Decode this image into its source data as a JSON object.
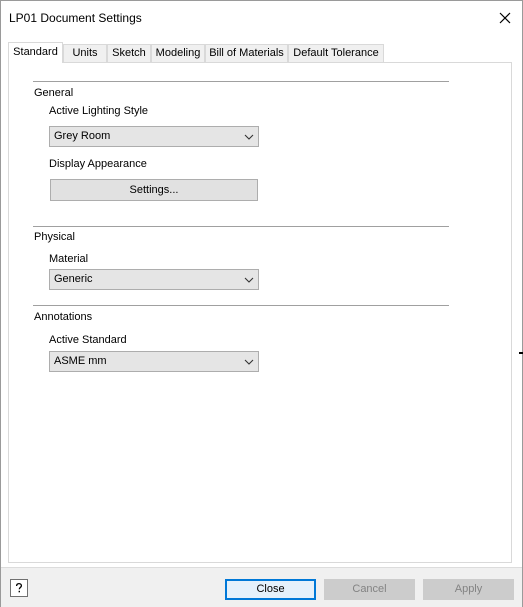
{
  "window": {
    "title": "LP01 Document Settings"
  },
  "tabs": [
    {
      "label": "Standard",
      "active": true
    },
    {
      "label": "Units",
      "active": false
    },
    {
      "label": "Sketch",
      "active": false
    },
    {
      "label": "Modeling",
      "active": false
    },
    {
      "label": "Bill of Materials",
      "active": false
    },
    {
      "label": "Default Tolerance",
      "active": false
    }
  ],
  "general": {
    "title": "General",
    "lighting_label": "Active Lighting Style",
    "lighting_value": "Grey Room",
    "display_label": "Display Appearance",
    "settings_button": "Settings..."
  },
  "physical": {
    "title": "Physical",
    "material_label": "Material",
    "material_value": "Generic"
  },
  "annotations": {
    "title": "Annotations",
    "standard_label": "Active Standard",
    "standard_value": "ASME mm"
  },
  "footer": {
    "close_label": "Close",
    "cancel_label": "Cancel",
    "apply_label": "Apply",
    "help_icon": "help-icon"
  },
  "colors": {
    "accent": "#0078d7",
    "disabled_bg": "#cccccc",
    "disabled_text": "#838383",
    "footer_bg": "#f0f0f0"
  }
}
